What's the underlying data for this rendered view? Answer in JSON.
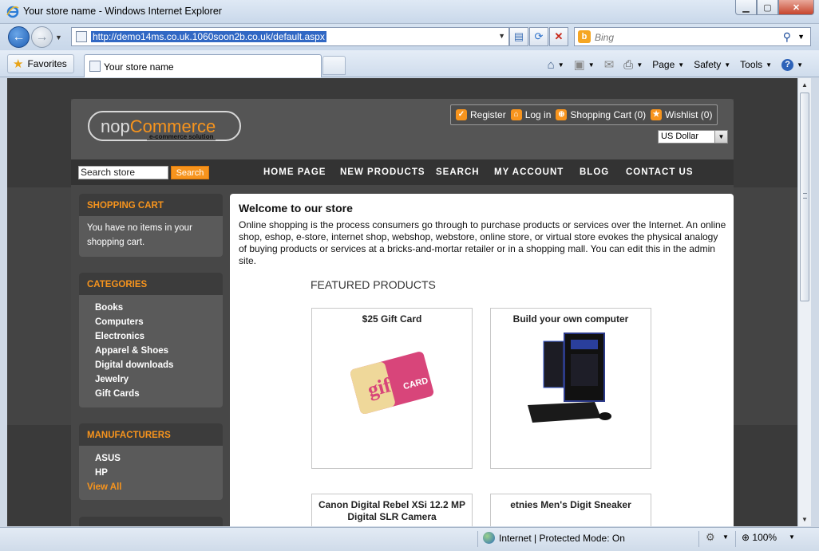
{
  "window": {
    "title": "Your store name - Windows Internet Explorer",
    "controls": {
      "minimize": "▁",
      "maximize": "▢",
      "close": "✕"
    }
  },
  "toolbar": {
    "url": "http://demo14ms.co.uk.1060soon2b.co.uk/default.aspx",
    "search_placeholder": "Bing",
    "favorites_label": "Favorites",
    "tab_title": "Your store name",
    "commands": [
      "Page",
      "Safety",
      "Tools"
    ]
  },
  "statusbar": {
    "zone": "Internet | Protected Mode: On",
    "zoom": "100%"
  },
  "store": {
    "logo": {
      "nop": "nop",
      "commerce": "Commerce",
      "tagline": "e-commerce solution"
    },
    "header_links": [
      "Register",
      "Log in",
      "Shopping Cart (0)",
      "Wishlist (0)"
    ],
    "currency": "US Dollar",
    "search": {
      "value": "Search store",
      "button": "Search"
    },
    "menu": [
      "HOME PAGE",
      "NEW PRODUCTS",
      "SEARCH",
      "MY ACCOUNT",
      "BLOG",
      "CONTACT US"
    ],
    "sidebar": {
      "cart": {
        "title": "SHOPPING CART",
        "text": "You have no items in your shopping cart."
      },
      "categories": {
        "title": "CATEGORIES",
        "items": [
          "Books",
          "Computers",
          "Electronics",
          "Apparel & Shoes",
          "Digital downloads",
          "Jewelry",
          "Gift Cards"
        ]
      },
      "manufacturers": {
        "title": "MANUFACTURERS",
        "items": [
          "ASUS",
          "HP"
        ],
        "view_all": "View All"
      }
    },
    "main": {
      "welcome_title": "Welcome to our store",
      "welcome_text": "Online shopping is the process consumers go through to purchase products or services over the Internet. An online shop, eshop, e-store, internet shop, webshop, webstore, online store, or virtual store evokes the physical analogy of buying products or services at a bricks-and-mortar retailer or in a shopping mall. You can edit this in the admin site.",
      "featured_title": "FEATURED PRODUCTS",
      "products": [
        {
          "name": "$25 Gift Card",
          "card_word": "gift",
          "card_sub": "CARD"
        },
        {
          "name": "Build your own computer"
        },
        {
          "name": "Canon Digital Rebel XSi 12.2 MP Digital SLR Camera"
        },
        {
          "name": "etnies Men's Digit Sneaker"
        }
      ]
    }
  }
}
